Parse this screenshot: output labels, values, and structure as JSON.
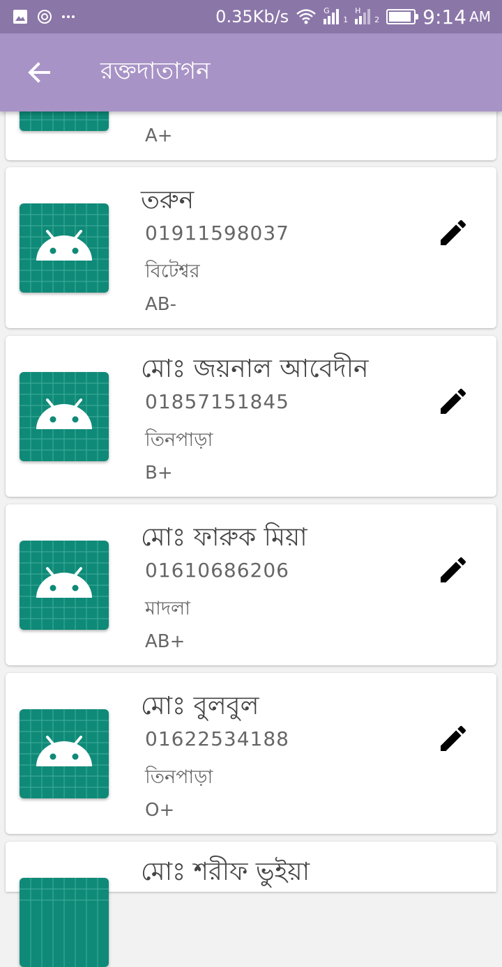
{
  "status_bar": {
    "speed": "0.35Kb/s",
    "sim1": "G",
    "sim1_slot": "1",
    "sim2": "H",
    "sim2_slot": "2",
    "time": "9:14",
    "ampm": "AM",
    "battery_level": 0.9
  },
  "app_bar": {
    "title": "রক্তদাতাগন"
  },
  "donors": [
    {
      "name": "",
      "phone": "",
      "area": "",
      "blood": "A+"
    },
    {
      "name": "তরুন",
      "phone": "01911598037",
      "area": "বিটেশ্বর",
      "blood": "AB-"
    },
    {
      "name": "মোঃ জয়নাল আবেদীন",
      "phone": "01857151845",
      "area": "তিনপাড়া",
      "blood": "B+"
    },
    {
      "name": "মোঃ ফারুক মিয়া",
      "phone": "01610686206",
      "area": "মাদলা",
      "blood": "AB+"
    },
    {
      "name": "মোঃ বুলবুল",
      "phone": "01622534188",
      "area": "তিনপাড়া",
      "blood": "O+"
    },
    {
      "name": "মোঃ শরীফ ভুইয়া",
      "phone": "",
      "area": "",
      "blood": ""
    }
  ],
  "colors": {
    "status_bar": "#8b76a8",
    "app_bar": "#a893c6",
    "avatar_bg": "#0f8a78",
    "icon": "#000000"
  },
  "icons": {
    "back": "arrow-left-icon",
    "edit": "pencil-icon",
    "avatar": "android-icon"
  }
}
